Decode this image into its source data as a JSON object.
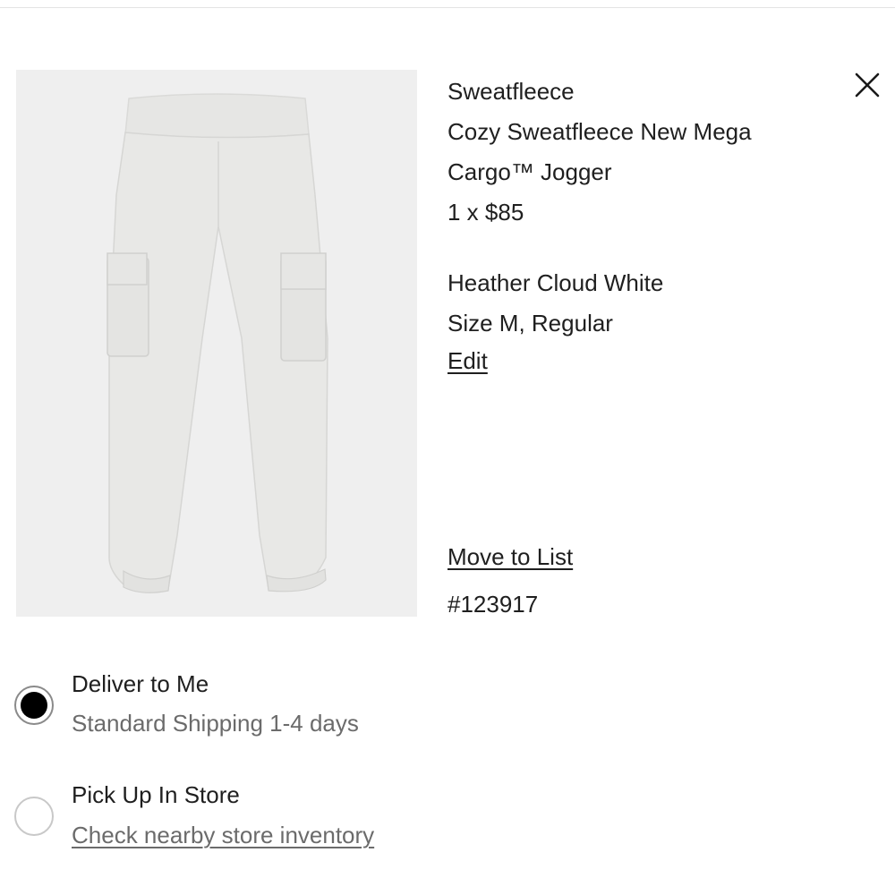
{
  "product": {
    "brand": "Sweatfleece",
    "name_line1": "Cozy Sweatfleece New Mega",
    "name_line2": "Cargo™ Jogger",
    "quantity_price": "1 x $85",
    "color": "Heather Cloud White",
    "size": "Size M, Regular",
    "edit_label": "Edit",
    "move_to_list_label": "Move to List",
    "item_number": "#123917",
    "image_icon": "jogger-pants-image"
  },
  "close": {
    "icon": "close-icon"
  },
  "fulfillment": {
    "options": [
      {
        "title": "Deliver to Me",
        "subtitle": "Standard Shipping 1-4 days",
        "selected": true
      },
      {
        "title": "Pick Up In Store",
        "subtitle": "Check nearby store inventory",
        "selected": false
      }
    ]
  },
  "colors": {
    "text": "#1f1f1f",
    "muted": "#6b6b6b",
    "image_bg": "#efefef",
    "radio_selected": "#000000"
  }
}
